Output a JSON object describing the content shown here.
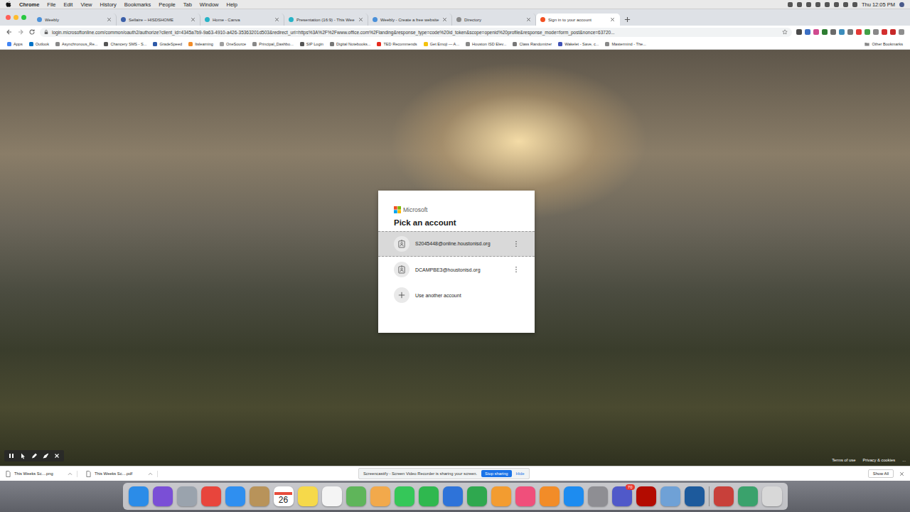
{
  "menubar": {
    "app": "Chrome",
    "menus": [
      "File",
      "Edit",
      "View",
      "History",
      "Bookmarks",
      "People",
      "Tab",
      "Window",
      "Help"
    ],
    "clock": "Thu 12:05 PM"
  },
  "tabs": [
    {
      "label": "Weebly",
      "selected": false,
      "color": "#4a90d9"
    },
    {
      "label": "Sellaire – HISDSHOME",
      "selected": false,
      "color": "#3b5fa8"
    },
    {
      "label": "Home - Canva",
      "selected": false,
      "color": "#27b3c7"
    },
    {
      "label": "Presentation (16:9) - This Wee",
      "selected": false,
      "color": "#27b3c7"
    },
    {
      "label": "Weebly - Create a free website",
      "selected": false,
      "color": "#4a90d9"
    },
    {
      "label": "Directory",
      "selected": false,
      "color": "#8a8a8a"
    },
    {
      "label": "Sign in to your account",
      "selected": true,
      "color": "#f25022"
    }
  ],
  "url": "login.microsoftonline.com/common/oauth2/authorize?client_id=4345a7b9-9a63-4910-a426-35363201d503&redirect_uri=https%3A%2F%2Fwww.office.com%2Flanding&response_type=code%20id_token&scope=openid%20profile&response_mode=form_post&nonce=63720...",
  "extensions": [
    {
      "color": "#4a4a4a"
    },
    {
      "color": "#3b6fc4"
    },
    {
      "color": "#d04a8f"
    },
    {
      "color": "#2e7d32"
    },
    {
      "color": "#6a6a6a"
    },
    {
      "color": "#3c8dbc"
    },
    {
      "color": "#777777"
    },
    {
      "color": "#e53935"
    },
    {
      "color": "#43a047"
    },
    {
      "color": "#888888"
    },
    {
      "color": "#d32f2f"
    },
    {
      "color": "#c62828"
    },
    {
      "color": "#8e8e8e"
    }
  ],
  "bookmarks": [
    {
      "label": "Apps",
      "color": "#4285f4"
    },
    {
      "label": "Outlook",
      "color": "#0072c6"
    },
    {
      "label": "Asynchronous_Re...",
      "color": "#888888"
    },
    {
      "label": "Chancery SMS - S...",
      "color": "#555555"
    },
    {
      "label": "GradeSpeed",
      "color": "#2e5aa8"
    },
    {
      "label": "Itslearning",
      "color": "#f28c28"
    },
    {
      "label": "OneSource",
      "color": "#9e9e9e"
    },
    {
      "label": "Principal_Dashbo...",
      "color": "#888888"
    },
    {
      "label": "SIP Login",
      "color": "#555555"
    },
    {
      "label": "Digital Notebooks...",
      "color": "#777777"
    },
    {
      "label": "TED Recommends",
      "color": "#e62b1e"
    },
    {
      "label": "Get Emoji — A...",
      "color": "#f4c20d"
    },
    {
      "label": "Houston ISD Elev...",
      "color": "#888888"
    },
    {
      "label": "Class Randomizer",
      "color": "#777777"
    },
    {
      "label": "Wakelet - Save, c...",
      "color": "#3f51b5"
    },
    {
      "label": "Mastermind - The...",
      "color": "#888888"
    }
  ],
  "other_bookmarks": "Other Bookmarks",
  "dialog": {
    "brand": "Microsoft",
    "title": "Pick an account",
    "accounts": [
      {
        "email": "S2045448@online.houstonisd.org",
        "selected": true
      },
      {
        "email": "DCAMPBE3@houstonisd.org",
        "selected": false
      }
    ],
    "add_account": "Use another account"
  },
  "footer": [
    "Terms of use",
    "Privacy & cookies",
    "..."
  ],
  "downloads": [
    {
      "name": "This Weeks Sc....png"
    },
    {
      "name": "This Weeks Sc....pdf"
    }
  ],
  "show_all": "Show All",
  "screencastify": {
    "message": "Screencastify - Screen Video Recorder is sharing your screen.",
    "stop": "Stop sharing",
    "hide": "Hide"
  },
  "dock": {
    "apps": [
      {
        "color": "#2b8ce8"
      },
      {
        "color": "#7a4fd6"
      },
      {
        "color": "#9aa3ad"
      },
      {
        "color": "#e8453c"
      },
      {
        "color": "#2f8ff0"
      },
      {
        "color": "#b8935a"
      },
      {
        "color": "#ffffff",
        "text": "26"
      },
      {
        "color": "#f6d94a"
      },
      {
        "color": "#f4f4f4"
      },
      {
        "color": "#5fb55a"
      },
      {
        "color": "#f2a94b"
      },
      {
        "color": "#35c759"
      },
      {
        "color": "#2fb84f"
      },
      {
        "color": "#2e73d9"
      },
      {
        "color": "#2fa84f"
      },
      {
        "color": "#f39c30"
      },
      {
        "color": "#f04f7b"
      },
      {
        "color": "#f28c28"
      },
      {
        "color": "#1d8cf0"
      },
      {
        "color": "#8e8e93"
      },
      {
        "color": "#5059c9",
        "badge": "70"
      },
      {
        "color": "#b30b00"
      },
      {
        "color": "#6fa1d6"
      },
      {
        "color": "#1d5a9c"
      }
    ],
    "stacks": [
      {
        "color": "#c8403a"
      },
      {
        "color": "#3aa26c"
      },
      {
        "color": "#d8d8d8"
      }
    ]
  }
}
